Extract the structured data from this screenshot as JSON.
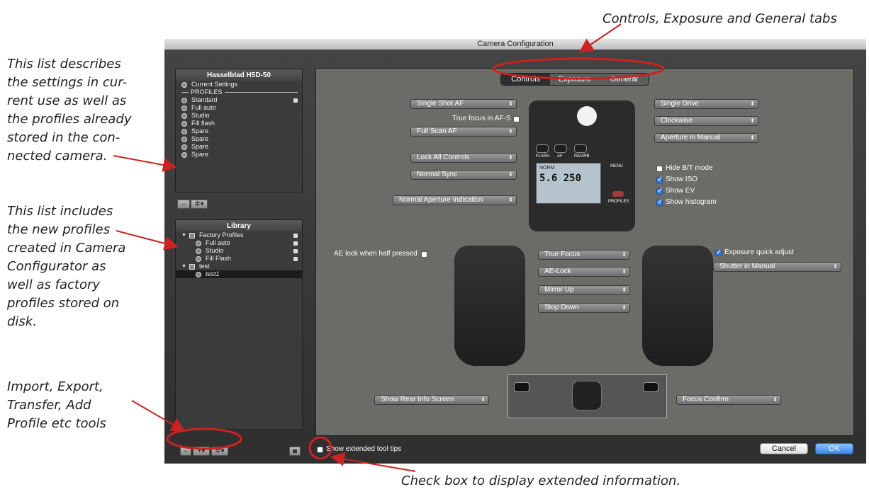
{
  "annotations": {
    "tabs_note": "Controls, Exposure and General tabs",
    "list_note": [
      "This list describes",
      "the settings in cur-",
      "rent use as well as",
      "the profiles already",
      "stored in the con-",
      "nected camera."
    ],
    "library_note": [
      "This list includes",
      "the new profiles",
      "created in Camera",
      "Configurator as",
      "well as factory",
      "profiles stored on",
      "disk."
    ],
    "tools_note": [
      "Import, Export,",
      "Transfer, Add",
      "Profile etc tools"
    ],
    "checkbox_note": "Check box to display extended information."
  },
  "window": {
    "title": "Camera Configuration"
  },
  "camera_panel": {
    "title": "Hasselblad H5D-50",
    "current": "Current Settings",
    "profiles_header": "PROFILES",
    "items": [
      "Standard",
      "Full auto",
      "Studio",
      "Fill flash",
      "Spare",
      "Spare",
      "Spare",
      "Spare"
    ],
    "locked": [
      true,
      false,
      false,
      false,
      false,
      false,
      false,
      false
    ]
  },
  "camera_tools": {
    "minus": "–",
    "gear": "✲▾"
  },
  "library": {
    "title": "Library",
    "groups": [
      {
        "name": "Factory Profiles",
        "items": [
          "Full auto",
          "Studio",
          "Fill Flash"
        ]
      },
      {
        "name": "test",
        "items": [
          "test1"
        ]
      }
    ]
  },
  "library_tools": {
    "minus": "–",
    "plus": "+▾",
    "gear": "✲▾"
  },
  "tabs": [
    "Controls",
    "Exposure",
    "General"
  ],
  "active_tab": "Controls",
  "controls": {
    "single_shot_af": "Single Shot AF",
    "true_focus_afs": "True focus in AF-S",
    "full_scan_af": "Full Scan AF",
    "lock_all": "Lock All Controls",
    "normal_sync": "Normal Sync",
    "normal_aperture": "Normal Aperture Indication",
    "single_drive": "Single Drive",
    "clockwise": "Clockwise",
    "aperture_manual": "Aperture in Manual",
    "hide_bt": "Hide B/T mode",
    "show_iso": "Show ISO",
    "show_ev": "Show EV",
    "show_histogram": "Show histogram",
    "ae_lock_half": "AE lock when half pressed",
    "true_focus": "True Focus",
    "ae_lock": "AE-Lock",
    "mirror_up": "Mirror Up",
    "stop_down": "Stop Down",
    "exposure_quick": "Exposure quick adjust",
    "shutter_manual": "Shutter in Manual",
    "show_rear": "Show Rear Info Screen",
    "focus_confirm": "Focus Confirm"
  },
  "camera_labels": {
    "flash": "FLASH",
    "af": "AF",
    "iso_wb": "ISO/WB",
    "menu": "MENU",
    "profiles": "PROFILES",
    "lcd_top": "NORM",
    "lcd_mid": "5.6  250"
  },
  "footer": {
    "extended_tooltips": "Show extended tool tips",
    "cancel": "Cancel",
    "ok": "OK"
  },
  "colors": {
    "highlight_circle": "#cc2222",
    "ok_button": "#3d86e8"
  }
}
